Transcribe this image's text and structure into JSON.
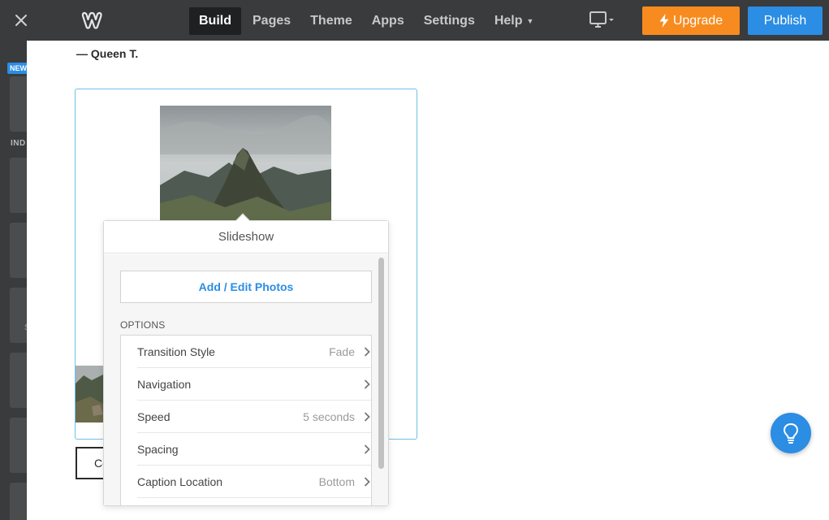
{
  "topbar": {
    "nav": [
      {
        "label": "Build",
        "active": true
      },
      {
        "label": "Pages",
        "active": false
      },
      {
        "label": "Theme",
        "active": false
      },
      {
        "label": "Apps",
        "active": false
      },
      {
        "label": "Settings",
        "active": false
      },
      {
        "label": "Help",
        "active": false
      }
    ],
    "upgrade_label": "Upgrade",
    "publish_label": "Publish",
    "icons": {
      "close": "close-icon",
      "logo": "weebly-logo",
      "device": "desktop-icon",
      "upgrade": "bolt-icon"
    }
  },
  "sidebar": {
    "badge": "NEW",
    "section_label": "IND",
    "partial_letter": "S"
  },
  "content": {
    "quote_attribution": "— Queen T.",
    "button_text": "Co"
  },
  "popover": {
    "title": "Slideshow",
    "add_photos_label": "Add / Edit Photos",
    "options_label": "OPTIONS",
    "options": [
      {
        "label": "Transition Style",
        "value": "Fade"
      },
      {
        "label": "Navigation",
        "value": ""
      },
      {
        "label": "Speed",
        "value": "5 seconds"
      },
      {
        "label": "Spacing",
        "value": ""
      },
      {
        "label": "Caption Location",
        "value": "Bottom"
      }
    ]
  },
  "colors": {
    "topbar": "#3a3b3c",
    "accent_blue": "#2b8de3",
    "upgrade_orange": "#f78b1f",
    "selection_border": "#6fc0e8"
  },
  "help_bubble_icon": "lightbulb-icon"
}
